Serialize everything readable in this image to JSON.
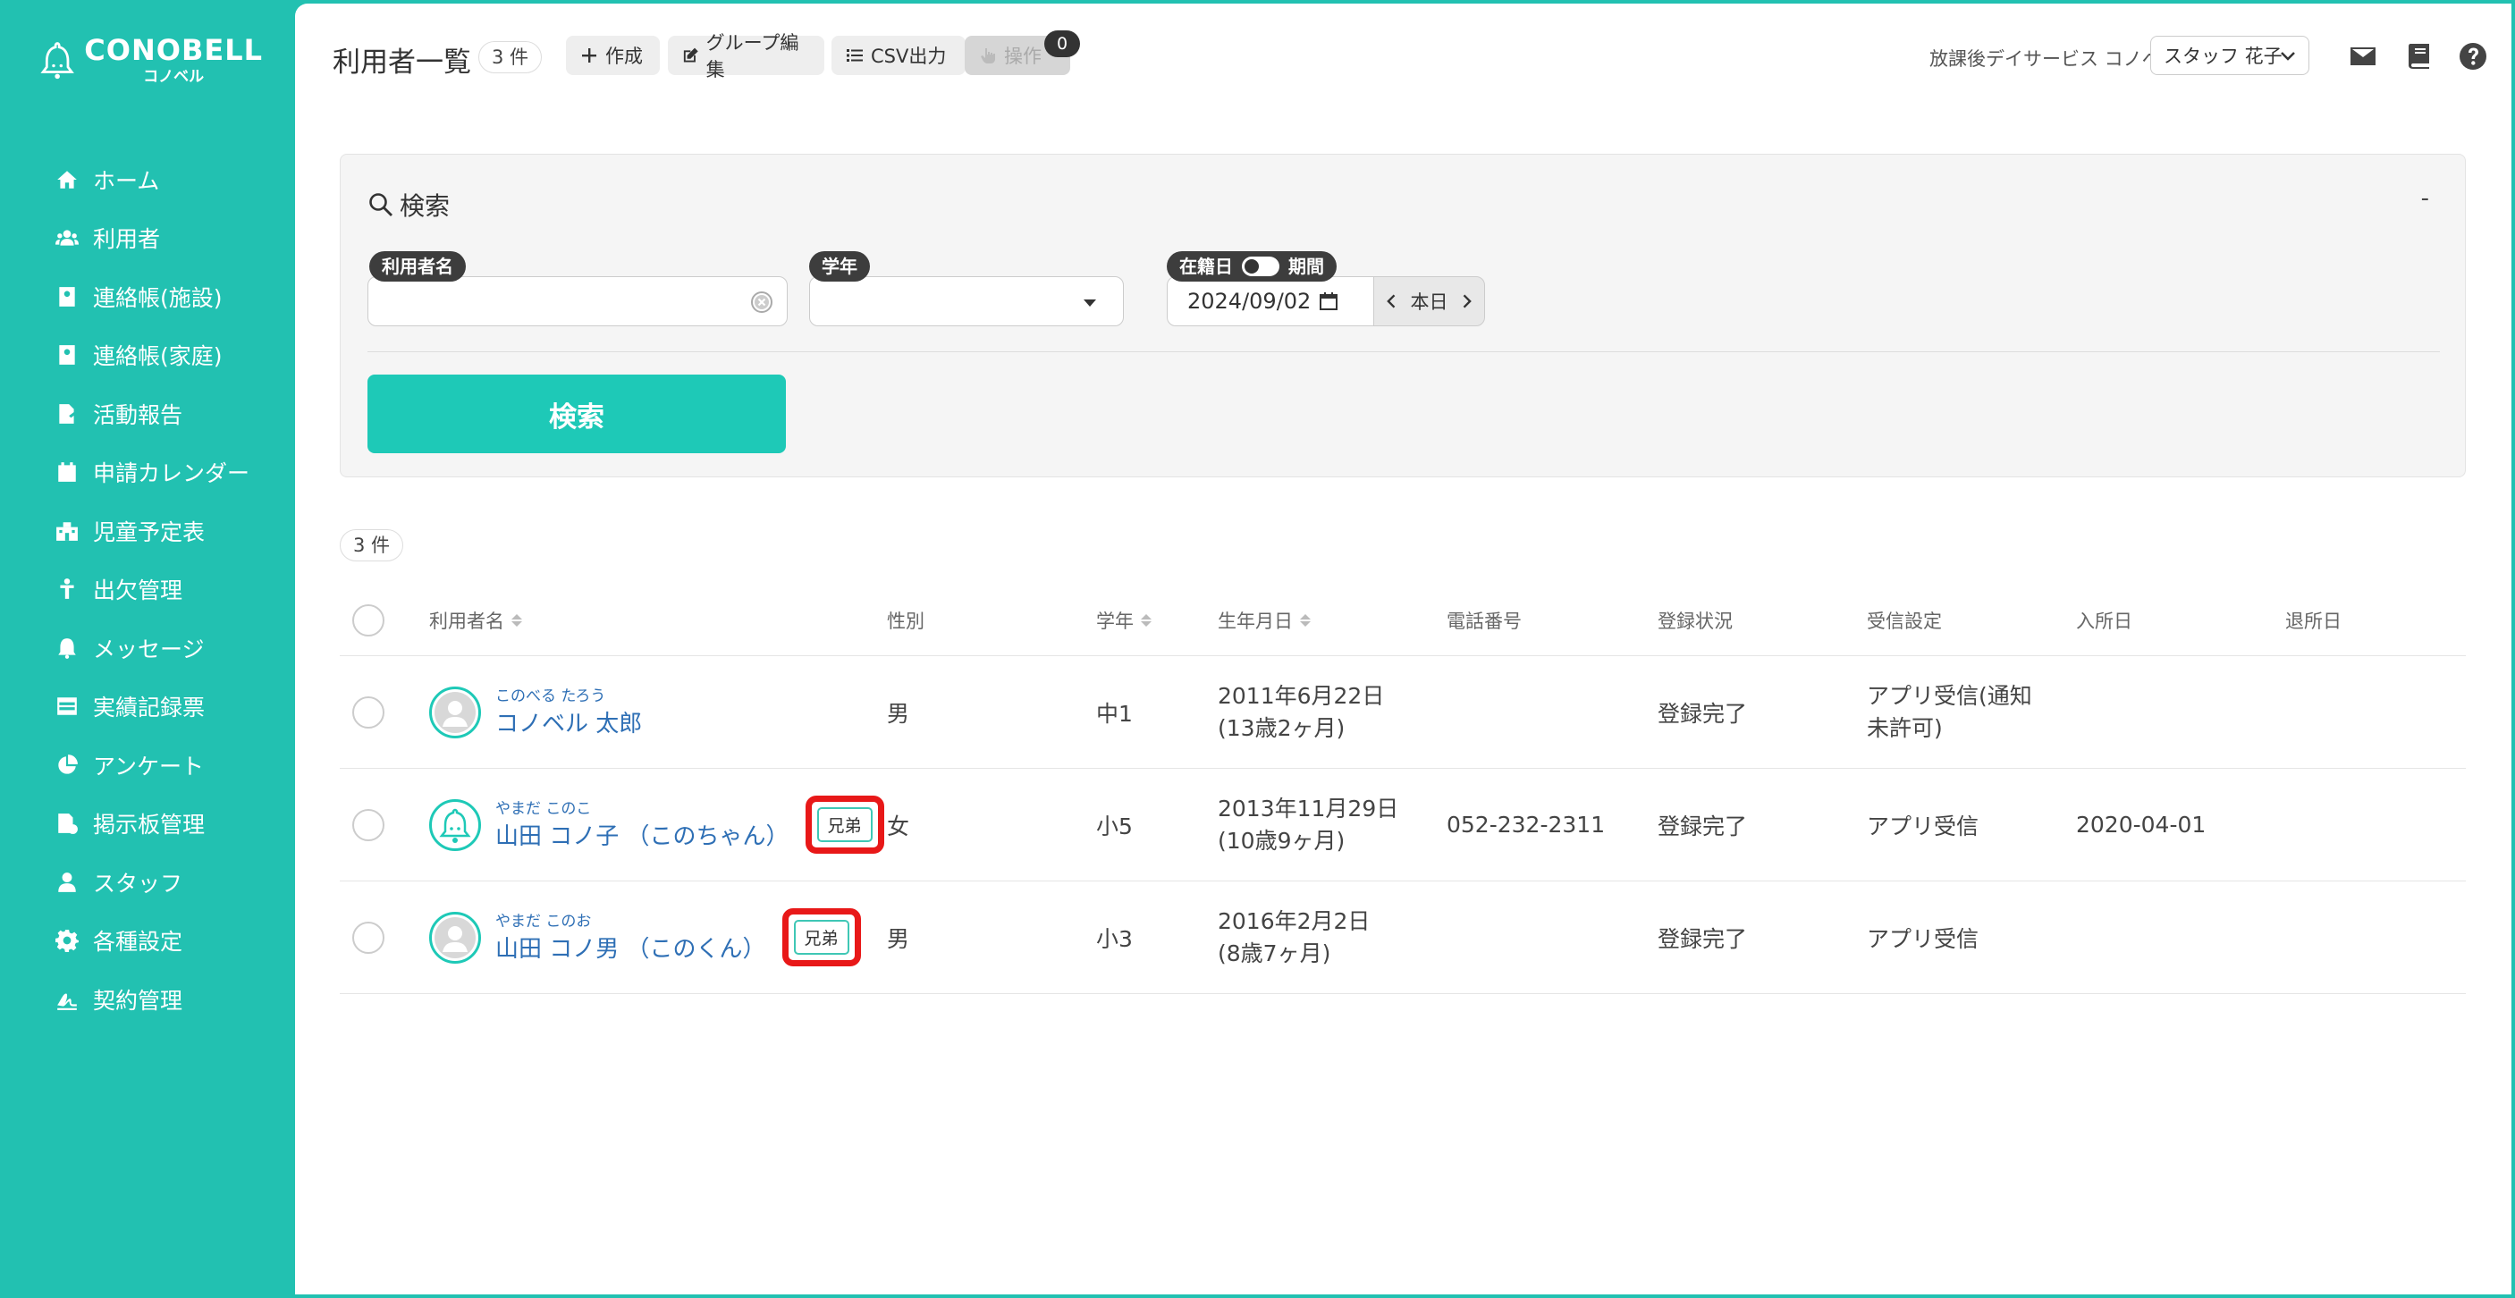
{
  "brand": {
    "name": "CONOBELL",
    "sub": "コノベル"
  },
  "sidebar": {
    "items": [
      {
        "label": "ホーム",
        "icon": "home-icon"
      },
      {
        "label": "利用者",
        "icon": "users-icon"
      },
      {
        "label": "連絡帳(施設)",
        "icon": "contact-book-icon"
      },
      {
        "label": "連絡帳(家庭)",
        "icon": "contact-book-icon"
      },
      {
        "label": "活動報告",
        "icon": "report-icon"
      },
      {
        "label": "申請カレンダー",
        "icon": "calendar-icon"
      },
      {
        "label": "児童予定表",
        "icon": "school-icon"
      },
      {
        "label": "出欠管理",
        "icon": "attendance-icon"
      },
      {
        "label": "メッセージ",
        "icon": "bell-icon"
      },
      {
        "label": "実績記録票",
        "icon": "table-icon"
      },
      {
        "label": "アンケート",
        "icon": "pie-chart-icon"
      },
      {
        "label": "掲示板管理",
        "icon": "board-icon"
      },
      {
        "label": "スタッフ",
        "icon": "staff-icon"
      },
      {
        "label": "各種設定",
        "icon": "gear-icon"
      },
      {
        "label": "契約管理",
        "icon": "contract-icon"
      }
    ]
  },
  "header": {
    "title": "利用者一覧",
    "count": "3 件",
    "buttons": {
      "create": "作成",
      "group_edit": "グループ編集",
      "csv": "CSV出力",
      "ops": "操作"
    },
    "ops_badge": "0",
    "facility": "放課後デイサービス コノベル",
    "staff": "スタッフ 花子"
  },
  "search": {
    "heading": "検索",
    "collapse": "-",
    "name_label": "利用者名",
    "name_value": "",
    "grade_label": "学年",
    "grade_value": "",
    "enroll_label": "在籍日",
    "period_label": "期間",
    "date_value": "2024/09/02",
    "today_label": "本日",
    "submit": "検索"
  },
  "results": {
    "count": "3 件",
    "columns": [
      "利用者名",
      "性別",
      "学年",
      "生年月日",
      "電話番号",
      "登録状況",
      "受信設定",
      "入所日",
      "退所日"
    ],
    "rows": [
      {
        "kana": "このべる たろう",
        "name": "コノベル 太郎",
        "sibling": "",
        "gender": "男",
        "grade": "中1",
        "birth": "2011年6月22日",
        "age": "(13歳2ヶ月)",
        "phone": "",
        "status": "登録完了",
        "recv1": "アプリ受信(通知",
        "recv2": "未許可)",
        "join": "",
        "leave": "",
        "avatar": "default"
      },
      {
        "kana": "やまだ このこ",
        "name": "山田 コノ子 （このちゃん）",
        "sibling": "兄弟",
        "gender": "女",
        "grade": "小5",
        "birth": "2013年11月29日",
        "age": "(10歳9ヶ月)",
        "phone": "052-232-2311",
        "status": "登録完了",
        "recv1": "アプリ受信",
        "recv2": "",
        "join": "2020-04-01",
        "leave": "",
        "avatar": "bell"
      },
      {
        "kana": "やまだ このお",
        "name": "山田 コノ男 （このくん）",
        "sibling": "兄弟",
        "gender": "男",
        "grade": "小3",
        "birth": "2016年2月2日",
        "age": "(8歳7ヶ月)",
        "phone": "",
        "status": "登録完了",
        "recv1": "アプリ受信",
        "recv2": "",
        "join": "",
        "leave": "",
        "avatar": "default"
      }
    ]
  },
  "colors": {
    "brand": "#22c1b1",
    "button": "#1ec9b7",
    "link": "#2e6fb5",
    "highlight": "#e81818"
  }
}
